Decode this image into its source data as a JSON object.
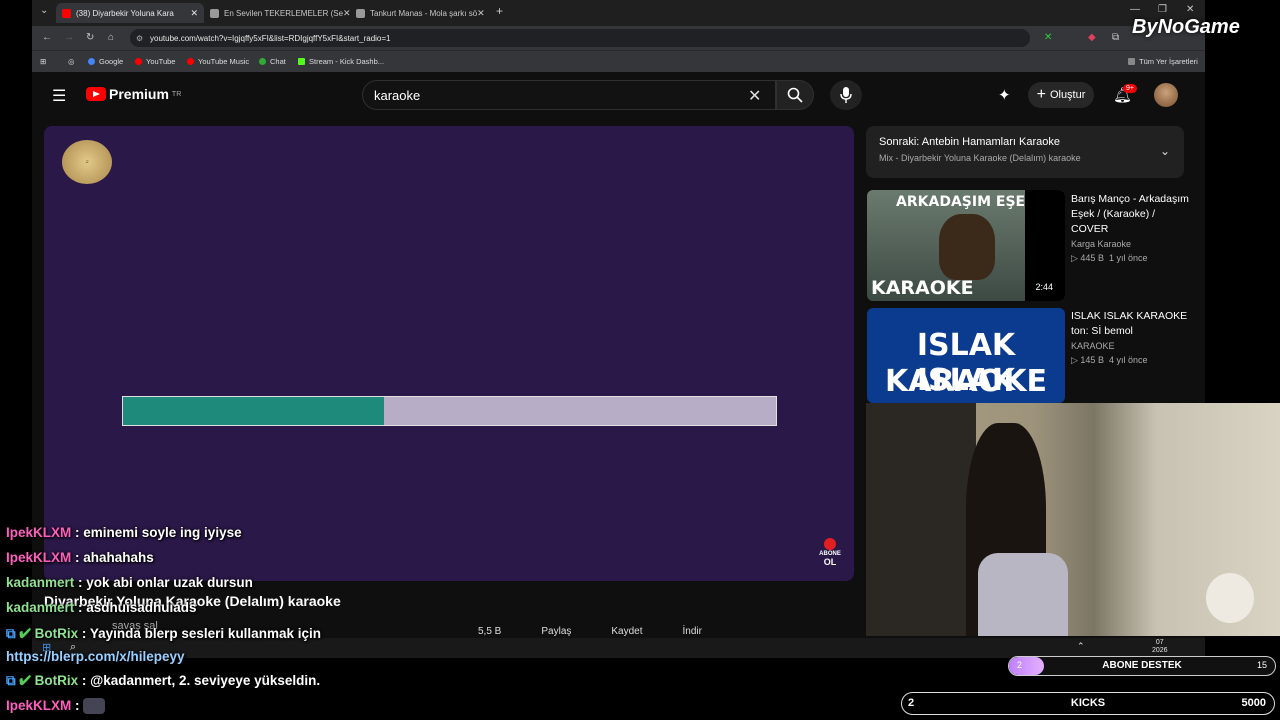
{
  "browser": {
    "tabs": [
      {
        "label": "(38) Diyarbekir Yoluna Kara",
        "active": true
      },
      {
        "label": "En Sevilen TEKERLEMELER (Se"
      },
      {
        "label": "Tankurt Manas - Mola şarkı sö"
      }
    ],
    "url": "youtube.com/watch?v=Igjqffy5xFI&list=RDIgjqffY5xFI&start_radio=1",
    "bookmarks": [
      "Google",
      "YouTube",
      "YouTube Music",
      "Chat",
      "Stream - Kick Dashb..."
    ],
    "all_bookmarks": "Tüm Yer İşaretleri"
  },
  "youtube": {
    "logo_text": "Premium",
    "country": "TR",
    "search_value": "karaoke",
    "create_label": "Oluştur",
    "notif_count": "9+",
    "progress_fraction": 0.4,
    "subscribe_badge": [
      "ABONE",
      "OL"
    ],
    "up_next": {
      "title": "Sonraki: Antebin Hamamları Karaoke",
      "subtitle": "Mix - Diyarbekir Yoluna Karaoke (Delalım) karaoke"
    },
    "recommended": [
      {
        "thumb_top": "ARKADAŞIM EŞEK",
        "thumb_bottom": "KARAOKE",
        "duration": "2:44",
        "title": "Barış Manço - Arkadaşım Eşek / (Karaoke) / COVER",
        "channel": "Karga Karaoke",
        "views": "445 B",
        "age": "1 yıl önce"
      },
      {
        "thumb_top": "ISLAK ISLAK",
        "thumb_bottom": "KARAOKE",
        "duration": "",
        "title": "ISLAK ISLAK KARAOKE ton: Sİ bemol",
        "channel": "KARAOKE",
        "views": "145 B",
        "age": "4 yıl önce"
      }
    ],
    "video_title": "Diyarbekir Yoluna Karaoke (Delalım) karaoke",
    "channel_partial": "savaş sal",
    "actions": [
      "5,5 B",
      "Paylaş",
      "Kaydet",
      "İndir"
    ]
  },
  "chat": [
    {
      "user": "IpekKLXM",
      "msg": "eminemi soyle ing iyiyse",
      "color": "u1"
    },
    {
      "user": "IpekKLXM",
      "msg": "ahahahahs",
      "color": "u1"
    },
    {
      "user": "kadanmert",
      "msg": "yok abi onlar uzak dursun",
      "color": "u2"
    },
    {
      "user": "kadanmert",
      "msg": "asdhuisadhuiads",
      "color": "u2"
    },
    {
      "user": "BotRix",
      "msg": "Yayında blerp sesleri kullanmak için",
      "color": "u2"
    },
    {
      "user": "",
      "msg": "https://blerp.com/x/hilepeyy",
      "color": "u3"
    },
    {
      "user": "BotRix",
      "msg": "@kadanmert, 2. seviyeye yükseldin.",
      "color": "u2"
    },
    {
      "user": "IpekKLXM",
      "msg": "",
      "color": "u1"
    }
  ],
  "taskbar": {
    "time": "07",
    "date": "2026"
  },
  "overlay": {
    "brand": "ByNoGame",
    "abone": {
      "label": "ABONE DESTEK",
      "current": "2",
      "goal": "15",
      "fraction": 0.133
    },
    "kicks": {
      "label": "KICKS",
      "current": "2",
      "goal": "5000"
    }
  }
}
